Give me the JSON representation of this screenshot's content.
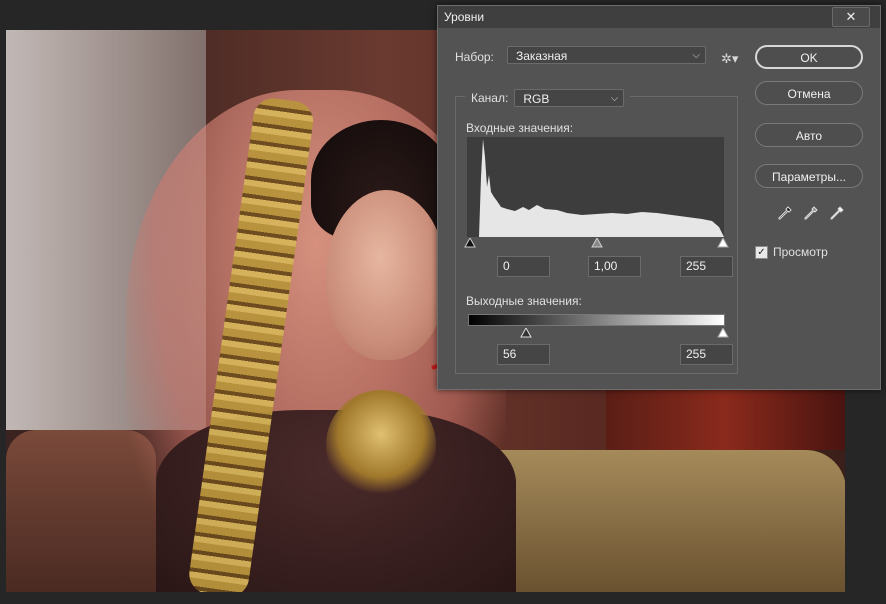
{
  "dialog": {
    "title": "Уровни",
    "close_glyph": "✕",
    "preset": {
      "label": "Набор:",
      "value": "Заказная"
    },
    "channel": {
      "label": "Канал:",
      "value": "RGB"
    },
    "input_levels": {
      "label": "Входные значения:",
      "black": "0",
      "gamma": "1,00",
      "white": "255"
    },
    "output_levels": {
      "label": "Выходные значения:",
      "black": "56",
      "white": "255"
    },
    "buttons": {
      "ok": "OK",
      "cancel": "Отмена",
      "auto": "Авто",
      "options": "Параметры..."
    },
    "preview": {
      "label": "Просмотр",
      "checked": true
    }
  },
  "icons": {
    "gear": "gear-icon",
    "droppers": [
      "black-eyedropper-icon",
      "gray-eyedropper-icon",
      "white-eyedropper-icon"
    ]
  },
  "colors": {
    "annotation": "#c0181a",
    "dialog_bg": "#535353"
  }
}
